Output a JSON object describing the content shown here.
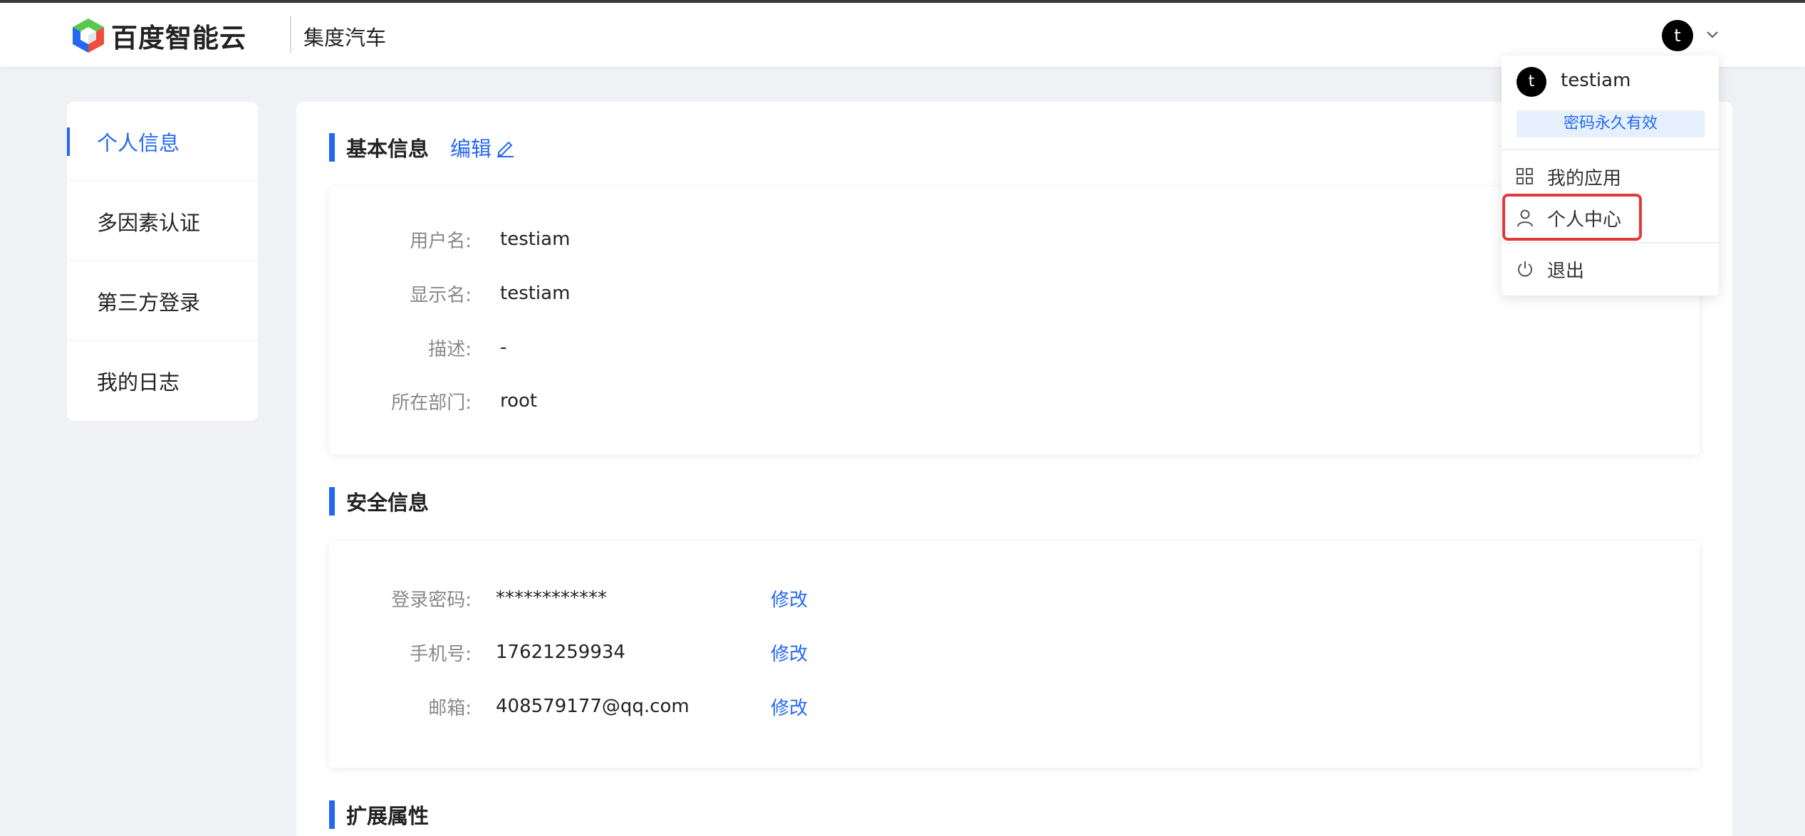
{
  "header": {
    "logo_text": "百度智能云",
    "app_name": "集度汽车",
    "avatar_initial": "t"
  },
  "sidebar": {
    "items": [
      {
        "label": "个人信息",
        "active": true
      },
      {
        "label": "多因素认证",
        "active": false
      },
      {
        "label": "第三方登录",
        "active": false
      },
      {
        "label": "我的日志",
        "active": false
      }
    ]
  },
  "basic_info": {
    "title": "基本信息",
    "edit_label": "编辑",
    "rows": [
      {
        "label": "用户名:",
        "value": "testiam"
      },
      {
        "label": "显示名:",
        "value": "testiam"
      },
      {
        "label": "描述:",
        "value": "-"
      },
      {
        "label": "所在部门:",
        "value": "root"
      }
    ]
  },
  "security_info": {
    "title": "安全信息",
    "rows": [
      {
        "label": "登录密码:",
        "value": "************",
        "action": "修改"
      },
      {
        "label": "手机号:",
        "value": "17621259934",
        "action": "修改"
      },
      {
        "label": "邮箱:",
        "value": "408579177@qq.com",
        "action": "修改"
      }
    ]
  },
  "extended": {
    "title": "扩展属性"
  },
  "user_menu": {
    "avatar_initial": "t",
    "username": "testiam",
    "password_badge": "密码永久有效",
    "items": [
      {
        "label": "我的应用",
        "icon": "grid-icon"
      },
      {
        "label": "个人中心",
        "icon": "user-icon"
      },
      {
        "label": "退出",
        "icon": "power-icon"
      }
    ]
  },
  "colors": {
    "accent": "#2468f2",
    "highlight": "#e03b3b",
    "background": "#f0f1f5"
  }
}
